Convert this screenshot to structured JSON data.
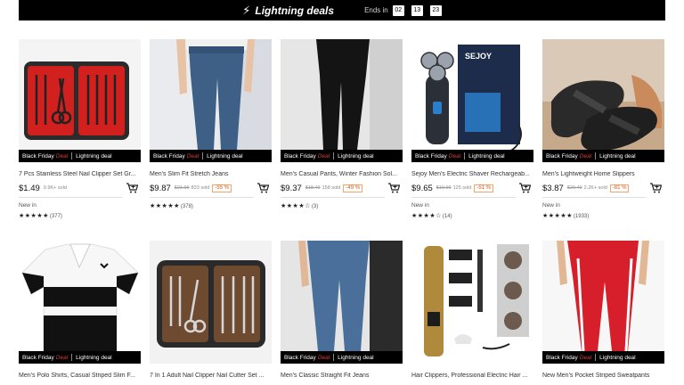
{
  "banner": {
    "title": "Lightning deals",
    "ends_label": "Ends in",
    "hours": "02",
    "minutes": "13",
    "seconds": "23"
  },
  "promo": {
    "black_friday": "Black Friday",
    "deal": "Deal",
    "lightning": "Lightning deal"
  },
  "products": [
    {
      "title": "7 Pcs Stainless Steel Nail Clipper Set Gr...",
      "price": "$1.49",
      "orig": "",
      "sold": "9.9K+ sold",
      "discount": "",
      "badge": "New in",
      "stars": "★★★★★",
      "reviews": "(377)"
    },
    {
      "title": "Men's Slim Fit Stretch Jeans",
      "price": "$9.87",
      "orig": "$21.99",
      "sold": "833 sold",
      "discount": "-55 %",
      "badge": "",
      "stars": "★★★★★",
      "reviews": "(378)"
    },
    {
      "title": "Men's Casual Pants, Winter Fashion Sol...",
      "price": "$9.37",
      "orig": "$18.49",
      "sold": "158 sold",
      "discount": "-49 %",
      "badge": "",
      "stars": "★★★★☆",
      "reviews": "(3)"
    },
    {
      "title": "Sejoy Men's Electric Shaver Rechargeab...",
      "price": "$9.65",
      "orig": "$19.99",
      "sold": "125 sold",
      "discount": "-51 %",
      "badge": "New in",
      "stars": "★★★★☆",
      "reviews": "(14)"
    },
    {
      "title": "Men's Lightweight Home Slippers",
      "price": "$3.87",
      "orig": "$20.49",
      "sold": "2.2K+ sold",
      "discount": "-81 %",
      "badge": "New in",
      "stars": "★★★★★",
      "reviews": "(1933)"
    },
    {
      "title": "Men's Polo Shirts, Casual Striped Slim F..."
    },
    {
      "title": "7 In 1 Adult Nail Clipper Nail Cutter Set ..."
    },
    {
      "title": "Men's Classic Straight Fit Jeans"
    },
    {
      "title": "Hair Clippers, Professional Electric Hair ..."
    },
    {
      "title": "New Men's Pocket Striped Sweatpants"
    }
  ]
}
